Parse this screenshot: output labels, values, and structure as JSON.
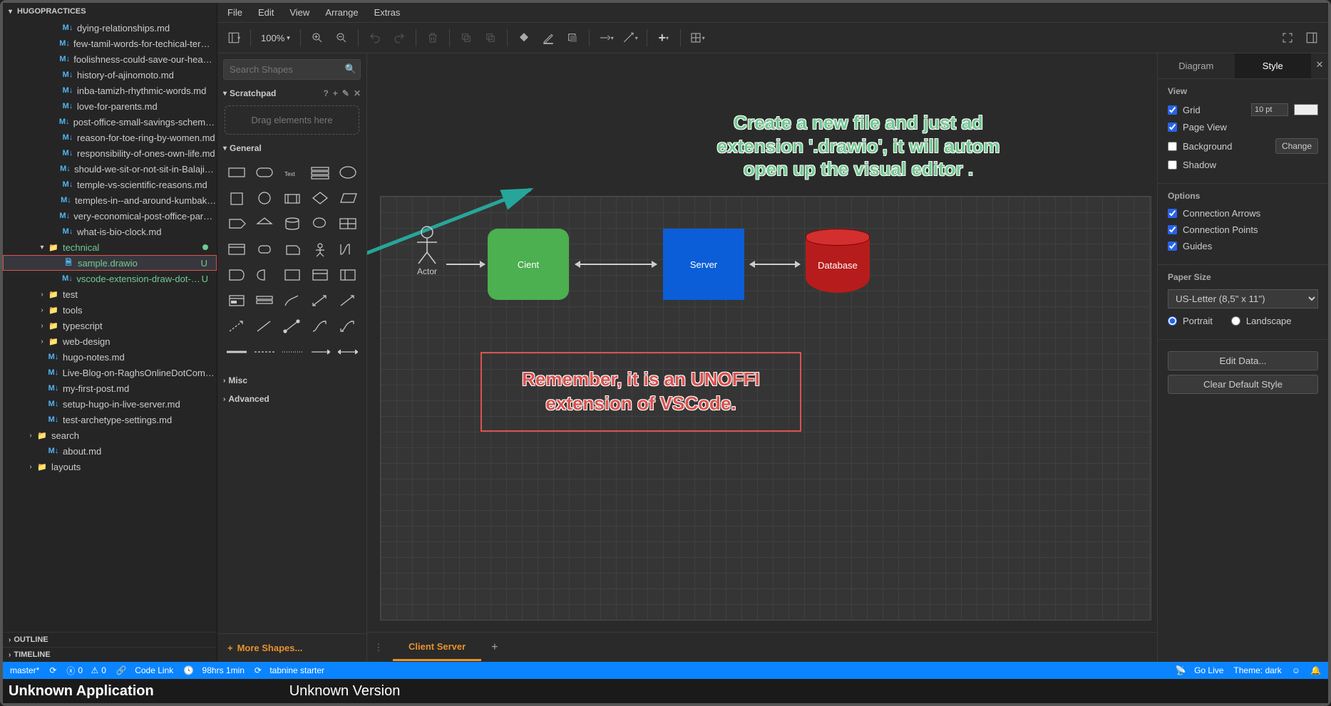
{
  "explorer": {
    "title": "HUGOPRACTICES",
    "files": [
      {
        "indent": 60,
        "icon": "M↓",
        "type": "md",
        "name": "dying-relationships.md"
      },
      {
        "indent": 60,
        "icon": "M↓",
        "type": "md",
        "name": "few-tamil-words-for-techical-terms.…"
      },
      {
        "indent": 60,
        "icon": "M↓",
        "type": "md",
        "name": "foolishness-could-save-our-heads.…"
      },
      {
        "indent": 60,
        "icon": "M↓",
        "type": "md",
        "name": "history-of-ajinomoto.md"
      },
      {
        "indent": 60,
        "icon": "M↓",
        "type": "md",
        "name": "inba-tamizh-rhythmic-words.md"
      },
      {
        "indent": 60,
        "icon": "M↓",
        "type": "md",
        "name": "love-for-parents.md"
      },
      {
        "indent": 60,
        "icon": "M↓",
        "type": "md",
        "name": "post-office-small-savings-scheme-f…"
      },
      {
        "indent": 60,
        "icon": "M↓",
        "type": "md",
        "name": "reason-for-toe-ring-by-women.md"
      },
      {
        "indent": 60,
        "icon": "M↓",
        "type": "md",
        "name": "responsibility-of-ones-own-life.md"
      },
      {
        "indent": 60,
        "icon": "M↓",
        "type": "md",
        "name": "should-we-sit-or-not-sit-in-Balaji-S…"
      },
      {
        "indent": 60,
        "icon": "M↓",
        "type": "md",
        "name": "temple-vs-scientific-reasons.md"
      },
      {
        "indent": 60,
        "icon": "M↓",
        "type": "md",
        "name": "temples-in--and-around-kumbako…"
      },
      {
        "indent": 60,
        "icon": "M↓",
        "type": "md",
        "name": "very-economical-post-office-parcel…"
      },
      {
        "indent": 60,
        "icon": "M↓",
        "type": "md",
        "name": "what-is-bio-clock.md"
      },
      {
        "indent": 40,
        "chev": "▾",
        "icon": "▢",
        "type": "folder-open",
        "name": "technical",
        "dotm": true,
        "untracked": true
      },
      {
        "indent": 60,
        "icon": "🗎",
        "type": "drawio",
        "name": "sample.drawio",
        "git": "U",
        "active": true,
        "untracked": true,
        "redbox": true
      },
      {
        "indent": 60,
        "icon": "M↓",
        "type": "md",
        "name": "vscode-extension-draw-dot-i…",
        "git": "U",
        "untracked": true
      },
      {
        "indent": 40,
        "chev": "›",
        "icon": "▢",
        "type": "folder",
        "name": "test"
      },
      {
        "indent": 40,
        "chev": "›",
        "icon": "▢",
        "type": "folder",
        "name": "tools"
      },
      {
        "indent": 40,
        "chev": "›",
        "icon": "▢",
        "type": "folder",
        "name": "typescript"
      },
      {
        "indent": 40,
        "chev": "›",
        "icon": "▢",
        "type": "folder",
        "name": "web-design"
      },
      {
        "indent": 40,
        "icon": "M↓",
        "type": "md",
        "name": "hugo-notes.md"
      },
      {
        "indent": 40,
        "icon": "M↓",
        "type": "md",
        "name": "Live-Blog-on-RaghsOnlineDotCom-…"
      },
      {
        "indent": 40,
        "icon": "M↓",
        "type": "md",
        "name": "my-first-post.md"
      },
      {
        "indent": 40,
        "icon": "M↓",
        "type": "md",
        "name": "setup-hugo-in-live-server.md"
      },
      {
        "indent": 40,
        "icon": "M↓",
        "type": "md",
        "name": "test-archetype-settings.md"
      },
      {
        "indent": 24,
        "chev": "›",
        "icon": "▢",
        "type": "folder",
        "name": "search"
      },
      {
        "indent": 40,
        "icon": "M↓",
        "type": "md",
        "name": "about.md"
      },
      {
        "indent": 24,
        "chev": "›",
        "icon": "▢",
        "type": "folder",
        "name": "layouts"
      }
    ],
    "panels": {
      "outline": "OUTLINE",
      "timeline": "TIMELINE"
    }
  },
  "menubar": [
    "File",
    "Edit",
    "View",
    "Arrange",
    "Extras"
  ],
  "toolbar": {
    "zoom": "100%"
  },
  "shapePanel": {
    "searchPlaceholder": "Search Shapes",
    "scratchpad": {
      "title": "Scratchpad",
      "hint": "Drag elements here"
    },
    "catGeneral": "General",
    "catMisc": "Misc",
    "catAdvanced": "Advanced",
    "moreShapes": "More Shapes..."
  },
  "canvas": {
    "actor": "Actor",
    "client": "Cient",
    "server": "Server",
    "database": "Database",
    "annoTop": "Create a new file and just ad\nextension '.drawio', it will autom\nopen up the visual editor   .",
    "annoBox": "Remember, it is an UNOFFI\nextension of VSCode.",
    "tab": "Client Server"
  },
  "rightPanel": {
    "tabDiagram": "Diagram",
    "tabStyle": "Style",
    "view": {
      "title": "View",
      "grid": "Grid",
      "gridSize": "10 pt",
      "pageView": "Page View",
      "background": "Background",
      "change": "Change",
      "shadow": "Shadow"
    },
    "options": {
      "title": "Options",
      "connArrows": "Connection Arrows",
      "connPoints": "Connection Points",
      "guides": "Guides"
    },
    "paper": {
      "title": "Paper Size",
      "size": "US-Letter (8,5\" x 11\")",
      "portrait": "Portrait",
      "landscape": "Landscape"
    },
    "editData": "Edit Data...",
    "clearStyle": "Clear Default Style"
  },
  "statusbar": {
    "branch": "master*",
    "errors": "0",
    "warnings": "0",
    "codelink": "Code Link",
    "wakatime": "98hrs 1min",
    "tabnine": "tabnine starter",
    "golive": "Go Live",
    "theme": "Theme: dark"
  },
  "bottomBar": {
    "app": "Unknown Application",
    "ver": "Unknown Version"
  }
}
